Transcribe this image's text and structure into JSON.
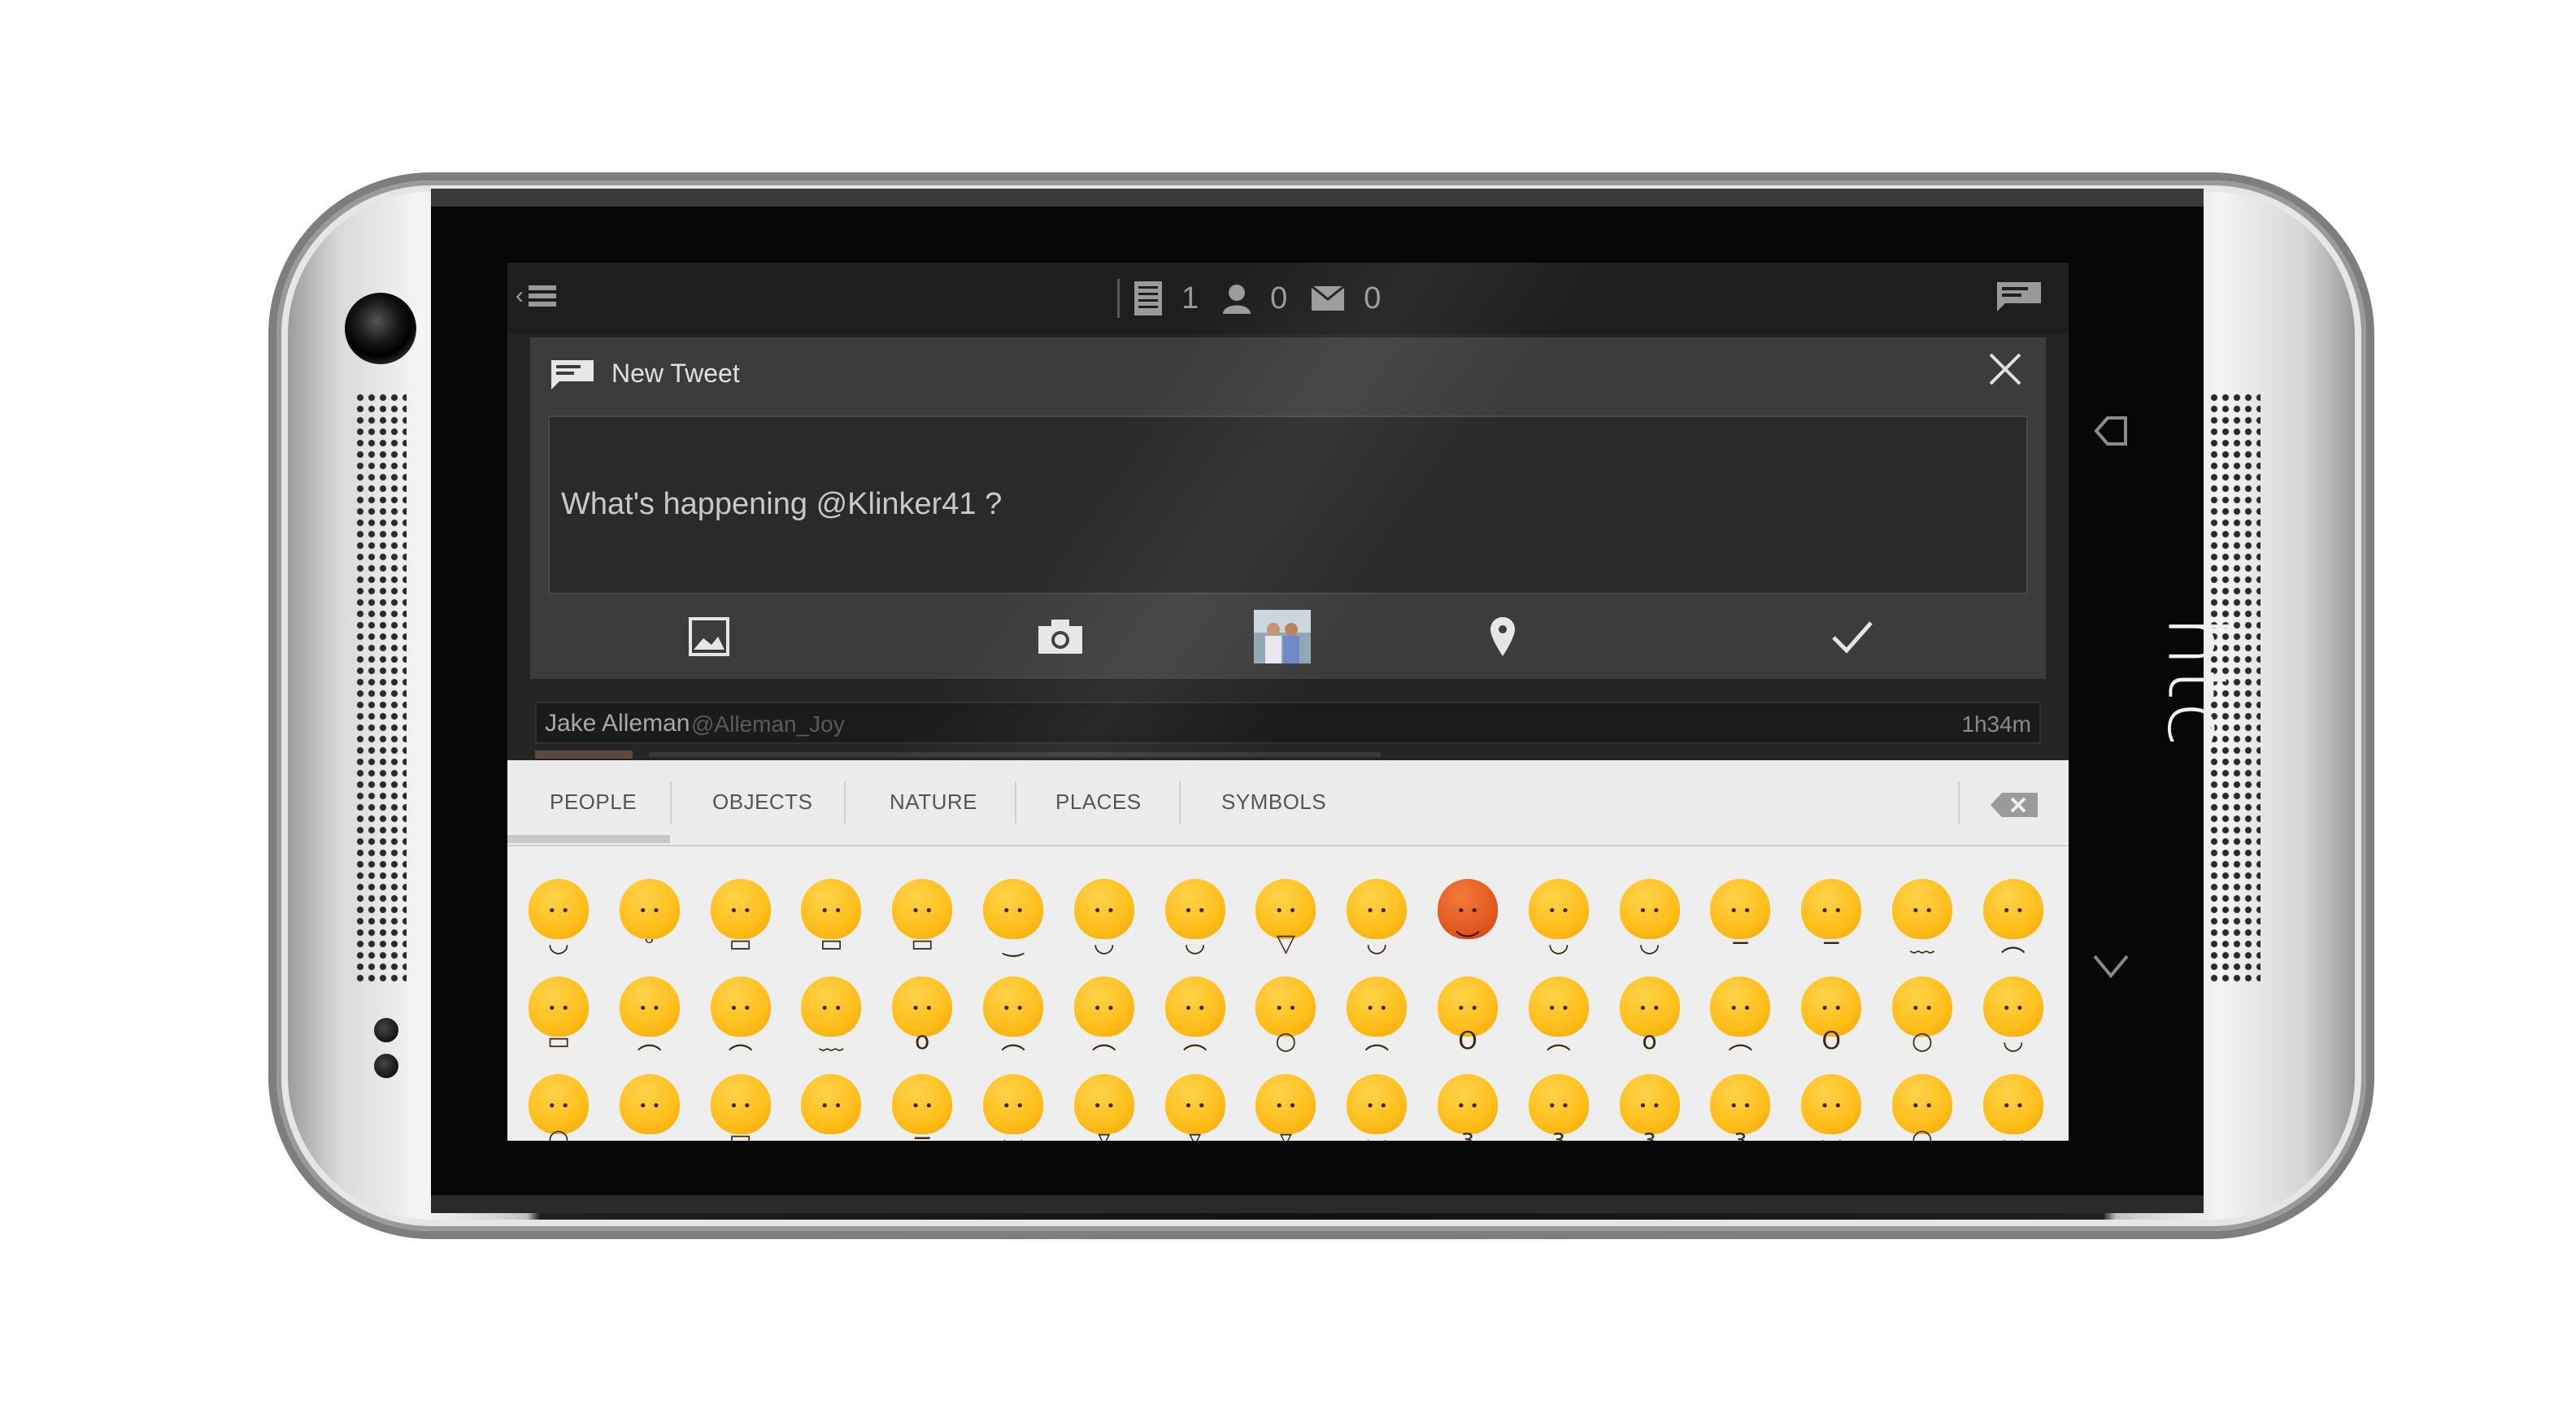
{
  "device": {
    "brand_logo": "htc"
  },
  "statusbar": {
    "counts": [
      {
        "icon": "timeline-icon",
        "value": "1"
      },
      {
        "icon": "mentions-icon",
        "value": "0"
      },
      {
        "icon": "messages-icon",
        "value": "0"
      }
    ]
  },
  "compose": {
    "title": "New Tweet",
    "placeholder": "What's happening @Klinker41 ?",
    "toolbar": [
      "attach-image-icon",
      "camera-icon",
      "profile-thumbnail",
      "location-pin-icon",
      "send-check-icon"
    ]
  },
  "timeline": {
    "name": "Jake Alleman",
    "handle": "@Alleman_Joy",
    "time": "1h34m"
  },
  "keyboard": {
    "tabs": [
      "PEOPLE",
      "OBJECTS",
      "NATURE",
      "PLACES",
      "SYMBOLS"
    ],
    "active_tab": "PEOPLE",
    "emoji_rows": [
      [
        "smile",
        "blush",
        "grin",
        "grin-wide",
        "joy-grin",
        "slight-smile",
        "happy-flushed",
        "sweat-smile",
        "laughing",
        "innocent",
        "imp",
        "wink",
        "tongue-wink",
        "neutral",
        "expressionless",
        "confused",
        "angry"
      ],
      [
        "grimace",
        "rage-small",
        "sad-tired",
        "sleepy",
        "hushed",
        "persevere",
        "steam",
        "disappointed",
        "weary",
        "cold-sweat",
        "scream",
        "sob",
        "astonished",
        "worried",
        "fearful-hands",
        "tired",
        "relieved"
      ],
      [
        "sob-loud",
        "no-mouth",
        "mask",
        "frowning",
        "unamused",
        "heart-eyes",
        "tongue",
        "tongue-yum",
        "squint-tongue",
        "smirk-wink",
        "kissing",
        "kissing-smile",
        "kiss-heart",
        "blush-kiss",
        "sunglasses",
        "weary-sob",
        "sleeping"
      ]
    ]
  }
}
